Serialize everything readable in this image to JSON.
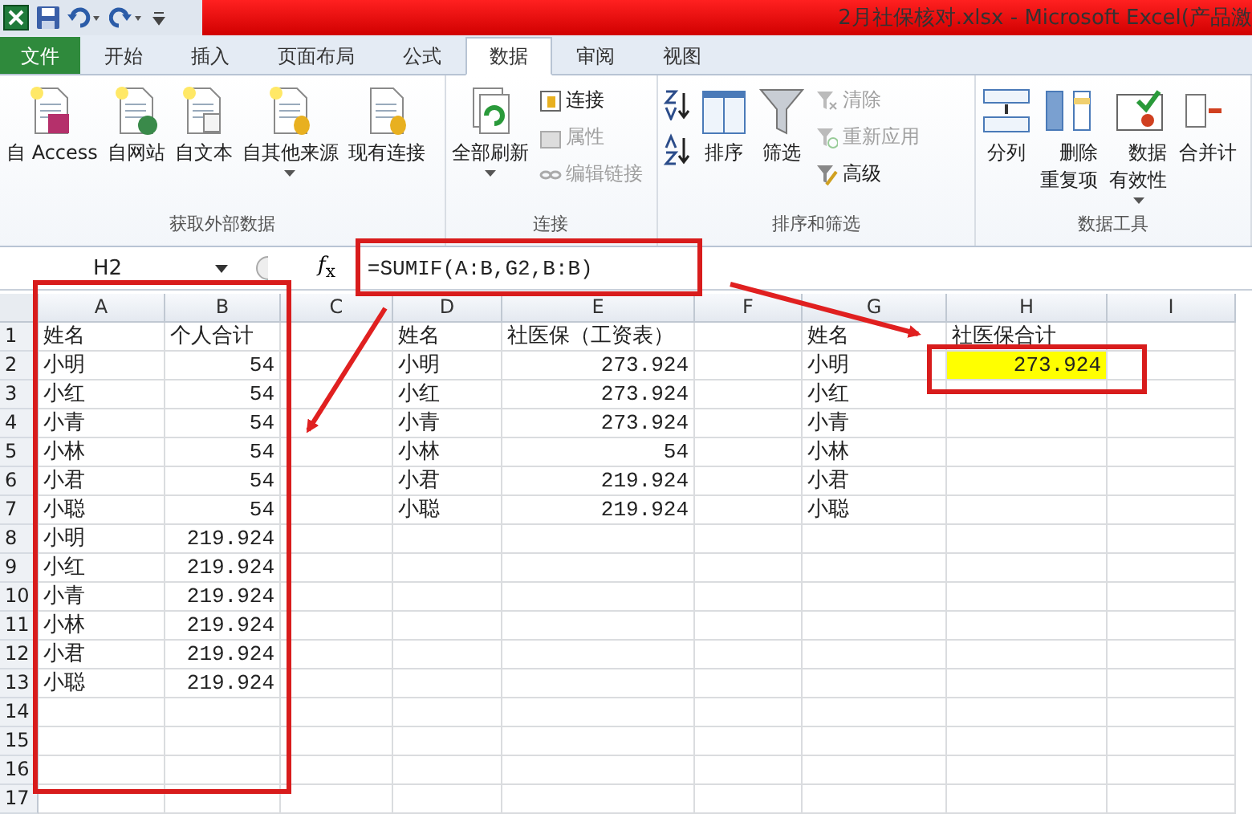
{
  "window": {
    "title": "2月社保核对.xlsx - Microsoft Excel(产品激"
  },
  "tabs": [
    {
      "label": "文件",
      "kind": "file",
      "selected": false
    },
    {
      "label": "开始",
      "kind": "tab",
      "selected": false
    },
    {
      "label": "插入",
      "kind": "tab",
      "selected": false
    },
    {
      "label": "页面布局",
      "kind": "tab",
      "selected": false
    },
    {
      "label": "公式",
      "kind": "tab",
      "selected": false
    },
    {
      "label": "数据",
      "kind": "tab",
      "selected": true
    },
    {
      "label": "审阅",
      "kind": "tab",
      "selected": false
    },
    {
      "label": "视图",
      "kind": "tab",
      "selected": false
    }
  ],
  "ribbon_groups": [
    {
      "label": "获取外部数据",
      "items": [
        {
          "label": "自 Access",
          "kind": "large",
          "dropdown": false
        },
        {
          "label": "自网站",
          "kind": "large",
          "dropdown": false
        },
        {
          "label": "自文本",
          "kind": "large",
          "dropdown": false
        },
        {
          "label": "自其他来源",
          "kind": "large",
          "dropdown": true
        },
        {
          "label": "现有连接",
          "kind": "large",
          "dropdown": false
        }
      ]
    },
    {
      "label": "连接",
      "items": [
        {
          "label": "全部刷新",
          "kind": "large",
          "dropdown": true
        },
        {
          "label": "连接",
          "kind": "small",
          "disabled": false
        },
        {
          "label": "属性",
          "kind": "small",
          "disabled": true
        },
        {
          "label": "编辑链接",
          "kind": "small",
          "disabled": true
        }
      ]
    },
    {
      "label": "排序和筛选",
      "items": [
        {
          "label": "排序",
          "kind": "large",
          "dropdown": false
        },
        {
          "label": "筛选",
          "kind": "large",
          "dropdown": false
        },
        {
          "label": "清除",
          "kind": "small",
          "disabled": true
        },
        {
          "label": "重新应用",
          "kind": "small",
          "disabled": true
        },
        {
          "label": "高级",
          "kind": "small",
          "disabled": false
        }
      ]
    },
    {
      "label": "数据工具",
      "items": [
        {
          "label": "分列",
          "kind": "large",
          "dropdown": false
        },
        {
          "label": "删除重复项",
          "kind": "large-wrap",
          "dropdown": false
        },
        {
          "label": "数据有效性",
          "kind": "large-wrap",
          "dropdown": true
        },
        {
          "label": "合并计",
          "kind": "large",
          "dropdown": false
        }
      ]
    }
  ],
  "name_box": "H2",
  "fx_button": "*f*$_{x}$",
  "formula": "=SUMIF(A:B,G2,B:B)",
  "columns": [
    "A",
    "B",
    "C",
    "D",
    "E",
    "F",
    "G",
    "H",
    "I"
  ],
  "rows": [
    {
      "number": "1",
      "cells": [
        {
          "text": "姓名",
          "kind": "text"
        },
        {
          "text": "个人合计",
          "kind": "text"
        },
        null,
        {
          "text": "姓名",
          "kind": "text"
        },
        {
          "text": "社医保（工资表）",
          "kind": "text"
        },
        null,
        {
          "text": "姓名",
          "kind": "text"
        },
        {
          "text": "社医保合计",
          "kind": "text"
        }
      ]
    },
    {
      "number": "2",
      "cells": [
        {
          "text": "小明",
          "kind": "text"
        },
        {
          "text": "54",
          "kind": "number"
        },
        null,
        {
          "text": "小明",
          "kind": "text"
        },
        {
          "text": "273.924",
          "kind": "number"
        },
        null,
        {
          "text": "小明",
          "kind": "text"
        },
        {
          "text": "273.924",
          "kind": "highlight"
        }
      ]
    },
    {
      "number": "3",
      "cells": [
        {
          "text": "小红",
          "kind": "text"
        },
        {
          "text": "54",
          "kind": "number"
        },
        null,
        {
          "text": "小红",
          "kind": "text"
        },
        {
          "text": "273.924",
          "kind": "number"
        },
        null,
        {
          "text": "小红",
          "kind": "text"
        }
      ]
    },
    {
      "number": "4",
      "cells": [
        {
          "text": "小青",
          "kind": "text"
        },
        {
          "text": "54",
          "kind": "number"
        },
        null,
        {
          "text": "小青",
          "kind": "text"
        },
        {
          "text": "273.924",
          "kind": "number"
        },
        null,
        {
          "text": "小青",
          "kind": "text"
        }
      ]
    },
    {
      "number": "5",
      "cells": [
        {
          "text": "小林",
          "kind": "text"
        },
        {
          "text": "54",
          "kind": "number"
        },
        null,
        {
          "text": "小林",
          "kind": "text"
        },
        {
          "text": "54",
          "kind": "number"
        },
        null,
        {
          "text": "小林",
          "kind": "text"
        }
      ]
    },
    {
      "number": "6",
      "cells": [
        {
          "text": "小君",
          "kind": "text"
        },
        {
          "text": "54",
          "kind": "number"
        },
        null,
        {
          "text": "小君",
          "kind": "text"
        },
        {
          "text": "219.924",
          "kind": "number"
        },
        null,
        {
          "text": "小君",
          "kind": "text"
        }
      ]
    },
    {
      "number": "7",
      "cells": [
        {
          "text": "小聪",
          "kind": "text"
        },
        {
          "text": "54",
          "kind": "number"
        },
        null,
        {
          "text": "小聪",
          "kind": "text"
        },
        {
          "text": "219.924",
          "kind": "number"
        },
        null,
        {
          "text": "小聪",
          "kind": "text"
        }
      ]
    },
    {
      "number": "8",
      "cells": [
        {
          "text": "小明",
          "kind": "text"
        },
        {
          "text": "219.924",
          "kind": "number"
        }
      ]
    },
    {
      "number": "9",
      "cells": [
        {
          "text": "小红",
          "kind": "text"
        },
        {
          "text": "219.924",
          "kind": "number"
        }
      ]
    },
    {
      "number": "10",
      "cells": [
        {
          "text": "小青",
          "kind": "text"
        },
        {
          "text": "219.924",
          "kind": "number"
        }
      ]
    },
    {
      "number": "11",
      "cells": [
        {
          "text": "小林",
          "kind": "text"
        },
        {
          "text": "219.924",
          "kind": "number"
        }
      ]
    },
    {
      "number": "12",
      "cells": [
        {
          "text": "小君",
          "kind": "text"
        },
        {
          "text": "219.924",
          "kind": "number"
        }
      ]
    },
    {
      "number": "13",
      "cells": [
        {
          "text": "小聪",
          "kind": "text"
        },
        {
          "text": "219.924",
          "kind": "number"
        }
      ]
    },
    {
      "number": "14",
      "cells": []
    },
    {
      "number": "15",
      "cells": []
    },
    {
      "number": "16",
      "cells": []
    },
    {
      "number": "17",
      "cells": []
    }
  ]
}
